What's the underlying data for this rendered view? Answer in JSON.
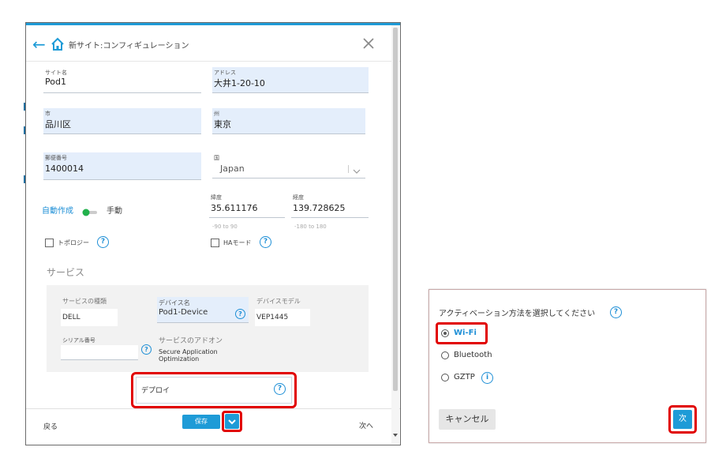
{
  "dialog": {
    "title": "新サイト:コンフィギュレーション",
    "fields": {
      "site_name": {
        "label": "サイト名",
        "value": "Pod1"
      },
      "address": {
        "label": "アドレス",
        "value": "大井1-20-10"
      },
      "city": {
        "label": "市",
        "value": "品川区"
      },
      "state": {
        "label": "州",
        "value": "東京"
      },
      "postal": {
        "label": "郵便番号",
        "value": "1400014"
      },
      "country": {
        "label": "国",
        "value": "Japan"
      },
      "latitude": {
        "label": "緯度",
        "value": "35.611176",
        "hint": "-90 to 90"
      },
      "longitude": {
        "label": "経度",
        "value": "139.728625",
        "hint": "-180 to 180"
      }
    },
    "toggle": {
      "auto_label": "自動作成",
      "manual_label": "手動"
    },
    "checkboxes": {
      "topology": "トポロジー",
      "ha_mode": "HAモード"
    },
    "services": {
      "section_title": "サービス",
      "service_type_label": "サービスの種類",
      "service_type_value": "DELL",
      "device_name_label": "デバイス名",
      "device_name_value": "Pod1-Device",
      "device_model_label": "デバイスモデル",
      "device_model_value": "VEP1445",
      "serial_label": "シリアル番号",
      "addon_label": "サービスのアドオン",
      "addon_value_1": "Secure Application",
      "addon_value_2": "Optimization"
    },
    "deploy_option": "デプロイ",
    "footer": {
      "back": "戻る",
      "save": "保存",
      "next": "次へ"
    }
  },
  "activation": {
    "title": "アクティベーション方法を選択してください",
    "options": [
      "Wi-Fi",
      "Bluetooth",
      "GZTP"
    ],
    "selected": "Wi-Fi",
    "cancel": "キャンセル",
    "next": "次"
  },
  "colors": {
    "accent": "#1e9bd7",
    "highlight": "#e10000",
    "field_fill": "#e4eefb"
  }
}
